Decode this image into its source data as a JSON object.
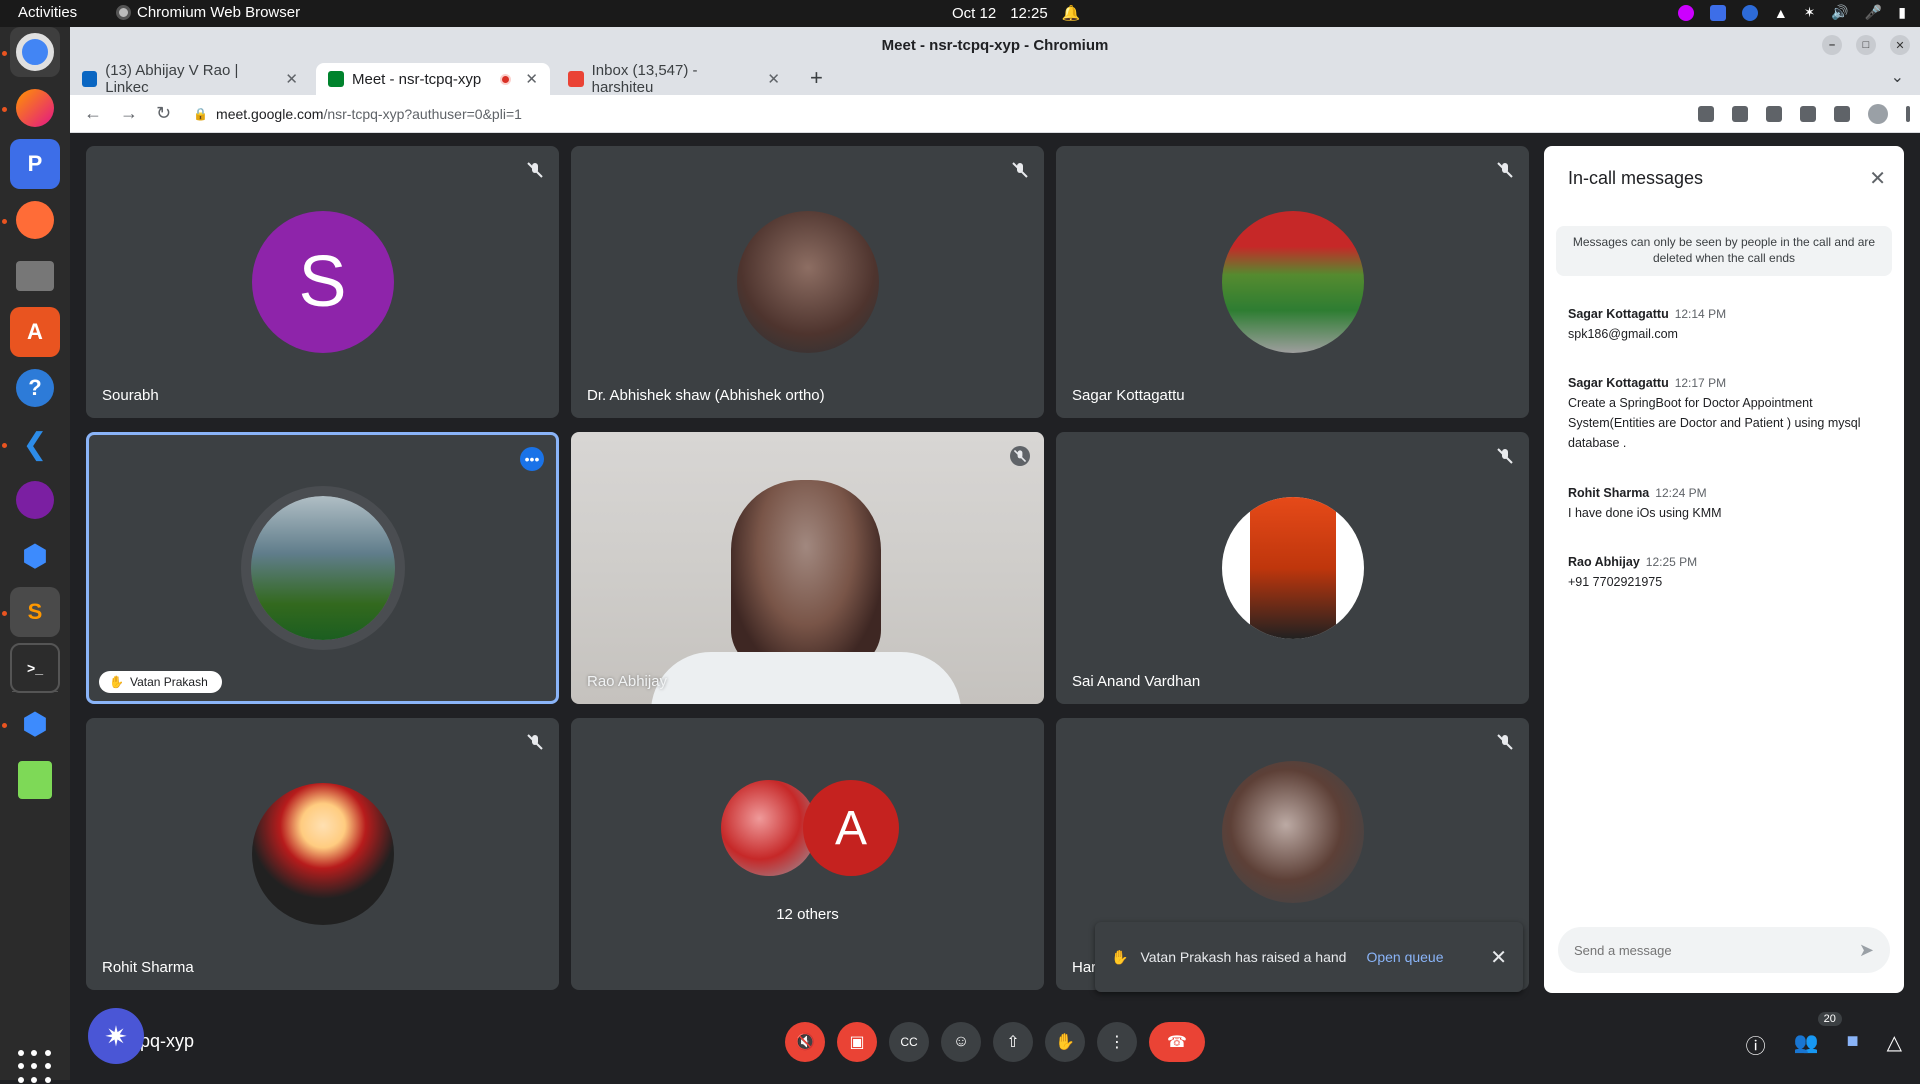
{
  "system": {
    "activities": "Activities",
    "app_name": "Chromium Web Browser",
    "clock_date": "Oct 12",
    "clock_time": "12:25"
  },
  "browser": {
    "window_title": "Meet - nsr-tcpq-xyp - Chromium",
    "tabs": [
      {
        "label": "(13) Abhijay V Rao | Linkec",
        "favicon_color": "#0a66c2"
      },
      {
        "label": "Meet - nsr-tcpq-xyp",
        "favicon_color": "#00832d"
      },
      {
        "label": "Inbox (13,547) - harshiteu",
        "favicon_color": "#ea4335"
      }
    ],
    "url_host": "meet.google.com",
    "url_path": "/nsr-tcpq-xyp?authuser=0&pli=1"
  },
  "tiles": [
    {
      "name": "Sourabh",
      "letter": "S",
      "color": "#8e24aa"
    },
    {
      "name": "Dr. Abhishek shaw (Abhishek ortho)"
    },
    {
      "name": "Sagar Kottagattu"
    },
    {
      "name": "Vatan Prakash"
    },
    {
      "name": "Rao Abhijay"
    },
    {
      "name": "Sai Anand Vardhan"
    },
    {
      "name": "Rohit Sharma"
    },
    {
      "name": "12 others",
      "letter": "A",
      "color": "#c5221f"
    },
    {
      "name": "Har"
    }
  ],
  "panel": {
    "title": "In-call messages",
    "notice": "Messages can only be seen by people in the call and are deleted when the call ends",
    "messages": [
      {
        "who": "Sagar Kottagattu",
        "time": "12:14 PM",
        "text": "spk186@gmail.com"
      },
      {
        "who": "Sagar Kottagattu",
        "time": "12:17 PM",
        "text": "Create a SpringBoot for Doctor Appointment System(Entities are Doctor and Patient ) using mysql database ."
      },
      {
        "who": "Rohit Sharma",
        "time": "12:24 PM",
        "text": "I have done iOs using KMM"
      },
      {
        "who": "Rao Abhijay",
        "time": "12:25 PM",
        "text": "+91 7702921975"
      }
    ],
    "send_placeholder": "Send a message"
  },
  "toast": {
    "text": "Vatan Prakash has raised a hand",
    "action": "Open queue"
  },
  "bottom": {
    "meeting_code": "pq-xyp",
    "participant_count": "20"
  }
}
